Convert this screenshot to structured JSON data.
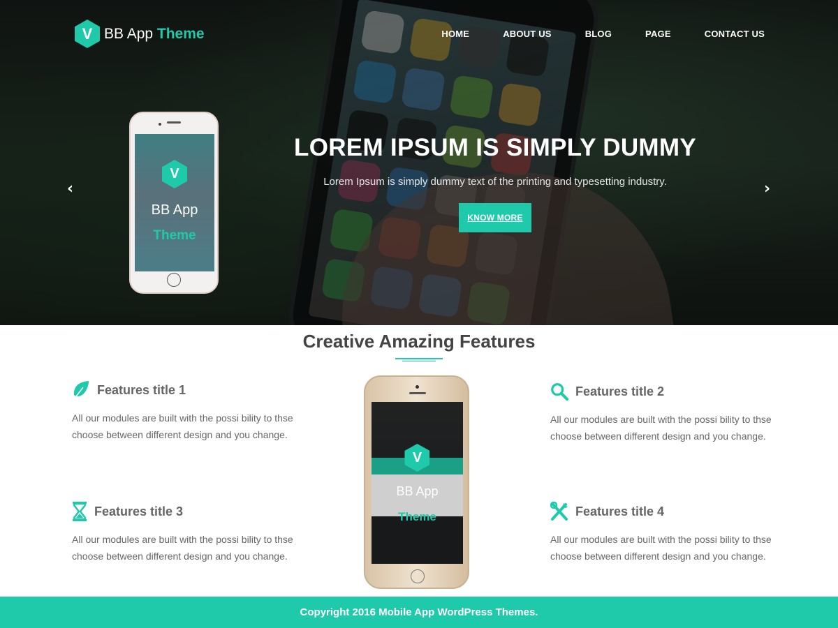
{
  "brand": {
    "letter": "V",
    "name": "BB App",
    "accent": "Theme",
    "color": "#1ecaa9"
  },
  "nav": [
    {
      "label": "HOME"
    },
    {
      "label": "ABOUT US"
    },
    {
      "label": "BLOG"
    },
    {
      "label": "PAGE"
    },
    {
      "label": "CONTACT US"
    }
  ],
  "hero": {
    "title": "LOREM IPSUM IS SIMPLY DUMMY",
    "subtitle": "Lorem Ipsum is simply dummy text of the printing and typesetting industry.",
    "button": "KNOW MORE",
    "prev_icon": "chevron-left-icon",
    "next_icon": "chevron-right-icon",
    "phone": {
      "letter": "V",
      "name": "BB App",
      "accent": "Theme"
    }
  },
  "features": {
    "title": "Creative Amazing Features",
    "items": [
      {
        "icon": "leaf-icon",
        "title": "Features title 1",
        "desc": "All our modules are built with the possi bility to thse choose between different design and you change."
      },
      {
        "icon": "search-icon",
        "title": "Features title 2",
        "desc": "All our modules are built with the possi bility to thse choose between different design and you change."
      },
      {
        "icon": "hourglass-icon",
        "title": "Features title 3",
        "desc": "All our modules are built with the possi bility to thse choose between different design and you change."
      },
      {
        "icon": "tools-icon",
        "title": "Features title 4",
        "desc": "All our modules are built with the possi bility to thse choose between different design and you change."
      }
    ],
    "phone": {
      "letter": "V",
      "name": "BB App",
      "accent": "Theme"
    }
  },
  "footer": {
    "copyright": "Copyright 2016 Mobile App WordPress Themes."
  }
}
